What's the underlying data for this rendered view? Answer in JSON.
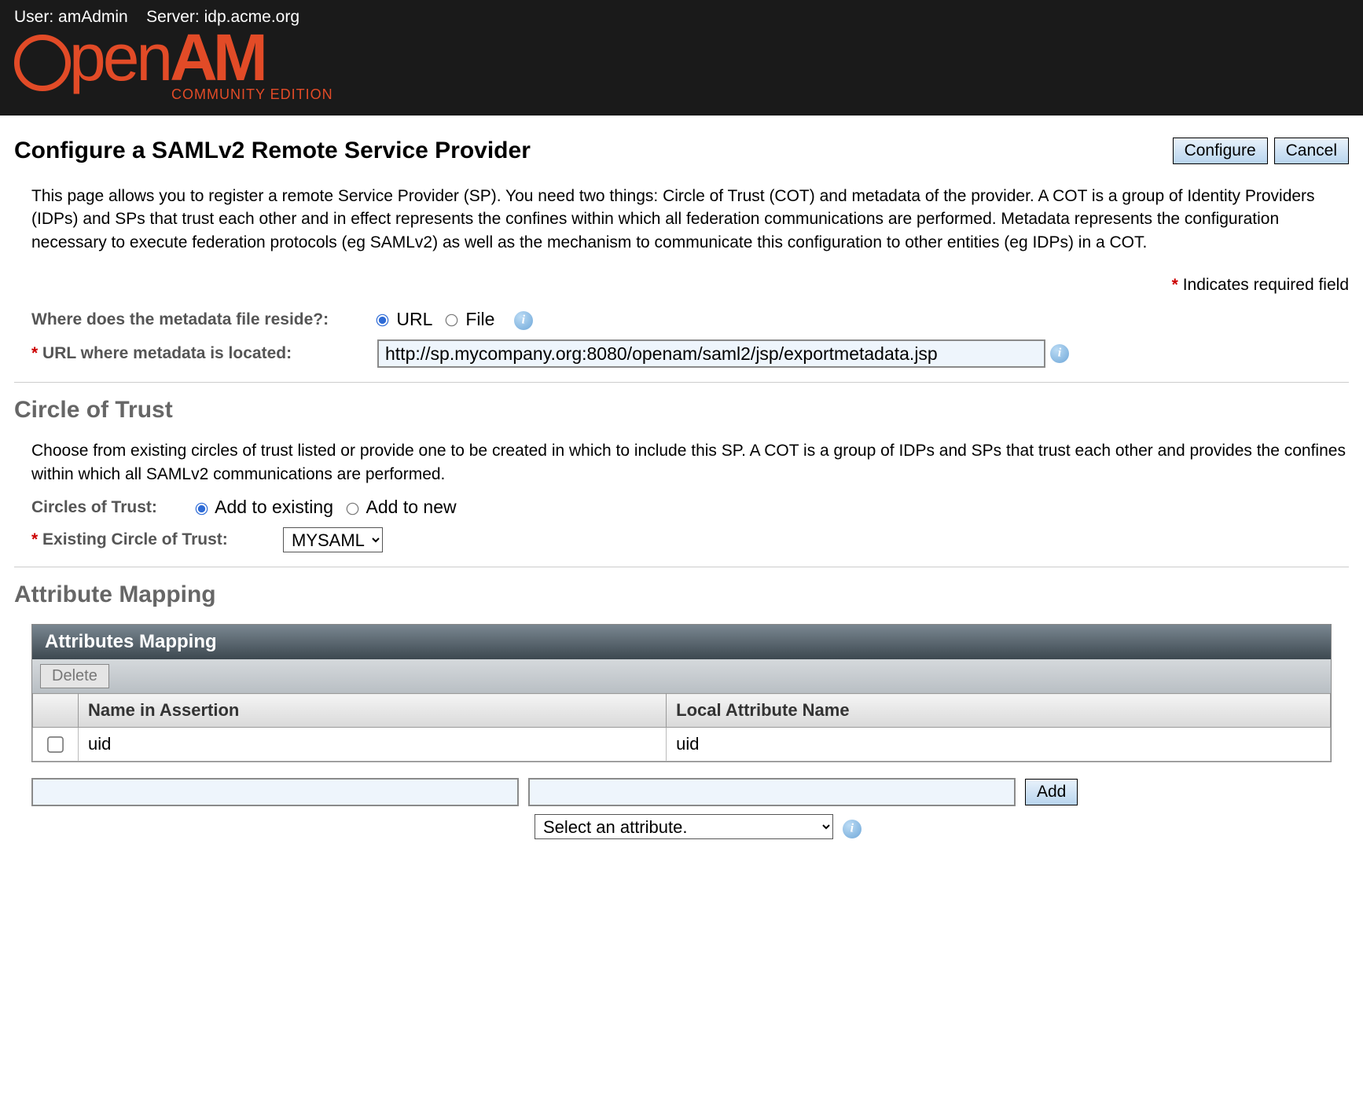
{
  "header": {
    "user_label": "User:",
    "user_value": "amAdmin",
    "server_label": "Server:",
    "server_value": "idp.acme.org",
    "logo_open": "Open",
    "logo_am": "AM",
    "logo_sub": "COMMUNITY EDITION"
  },
  "page": {
    "title": "Configure a SAMLv2 Remote Service Provider",
    "configure_btn": "Configure",
    "cancel_btn": "Cancel",
    "intro": "This page allows you to register a remote Service Provider (SP). You need two things: Circle of Trust (COT) and metadata of the provider. A COT is a group of Identity Providers (IDPs) and SPs that trust each other and in effect represents the confines within which all federation communications are performed. Metadata represents the configuration necessary to execute federation protocols (eg SAMLv2) as well as the mechanism to communicate this configuration to other entities (eg IDPs) in a COT.",
    "required_note": "Indicates required field"
  },
  "metadata": {
    "where_label": "Where does the metadata file reside?:",
    "url_option": "URL",
    "file_option": "File",
    "url_label": "URL where metadata is located:",
    "url_value": "http://sp.mycompany.org:8080/openam/saml2/jsp/exportmetadata.jsp"
  },
  "cot": {
    "heading": "Circle of Trust",
    "desc": "Choose from existing circles of trust listed or provide one to be created in which to include this SP. A COT is a group of IDPs and SPs that trust each other and provides the confines within which all SAMLv2 communications are performed.",
    "cot_label": "Circles of Trust:",
    "add_existing": "Add to existing",
    "add_new": "Add to new",
    "existing_label": "Existing Circle of Trust:",
    "existing_value": "MYSAML"
  },
  "mapping": {
    "heading": "Attribute Mapping",
    "panel_title": "Attributes Mapping",
    "delete_btn": "Delete",
    "col_assertion": "Name in Assertion",
    "col_local": "Local Attribute Name",
    "rows": [
      {
        "assertion": "uid",
        "local": "uid"
      }
    ],
    "add_btn": "Add",
    "select_placeholder": "Select an attribute."
  }
}
